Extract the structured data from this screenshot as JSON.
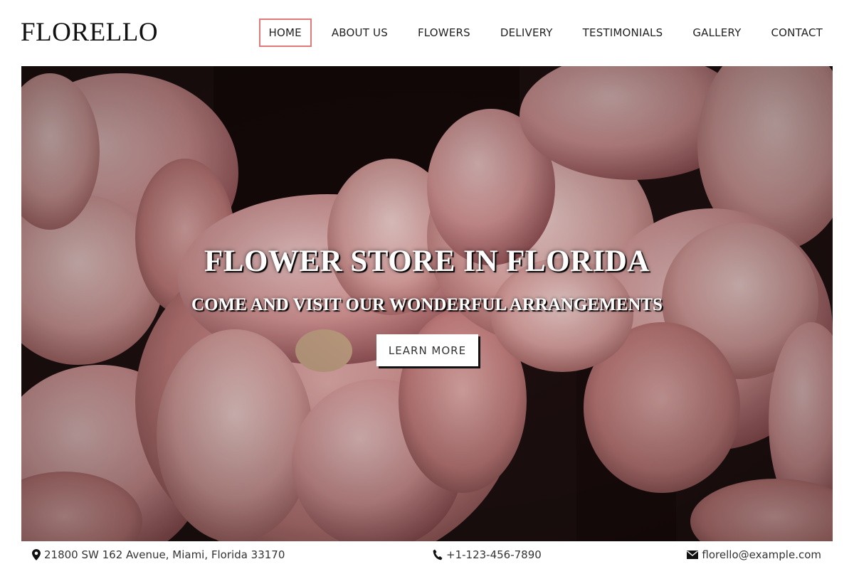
{
  "header": {
    "logo": "FLORELLO",
    "nav": [
      {
        "label": "HOME",
        "active": true
      },
      {
        "label": "ABOUT US"
      },
      {
        "label": "FLOWERS"
      },
      {
        "label": "DELIVERY"
      },
      {
        "label": "TESTIMONIALS"
      },
      {
        "label": "GALLERY"
      },
      {
        "label": "CONTACT"
      }
    ]
  },
  "hero": {
    "title": "FLOWER STORE IN FLORIDA",
    "subtitle": "COME AND VISIT OUR WONDERFUL ARRANGEMENTS",
    "button_label": "LEARN MORE",
    "image_description_colors": {
      "petal": "#d9a0a0",
      "dark": "#1a0d0d"
    }
  },
  "contact": {
    "address": "21800 SW 162 Avenue, Miami, Florida 33170",
    "address_icon": "map-marker-icon",
    "phone": "+1-123-456-7890",
    "phone_icon": "phone-icon",
    "email": "florello@example.com",
    "email_icon": "envelope-icon"
  },
  "colors": {
    "accent": "#e07a7a",
    "text": "#222222",
    "background": "#ffffff"
  }
}
